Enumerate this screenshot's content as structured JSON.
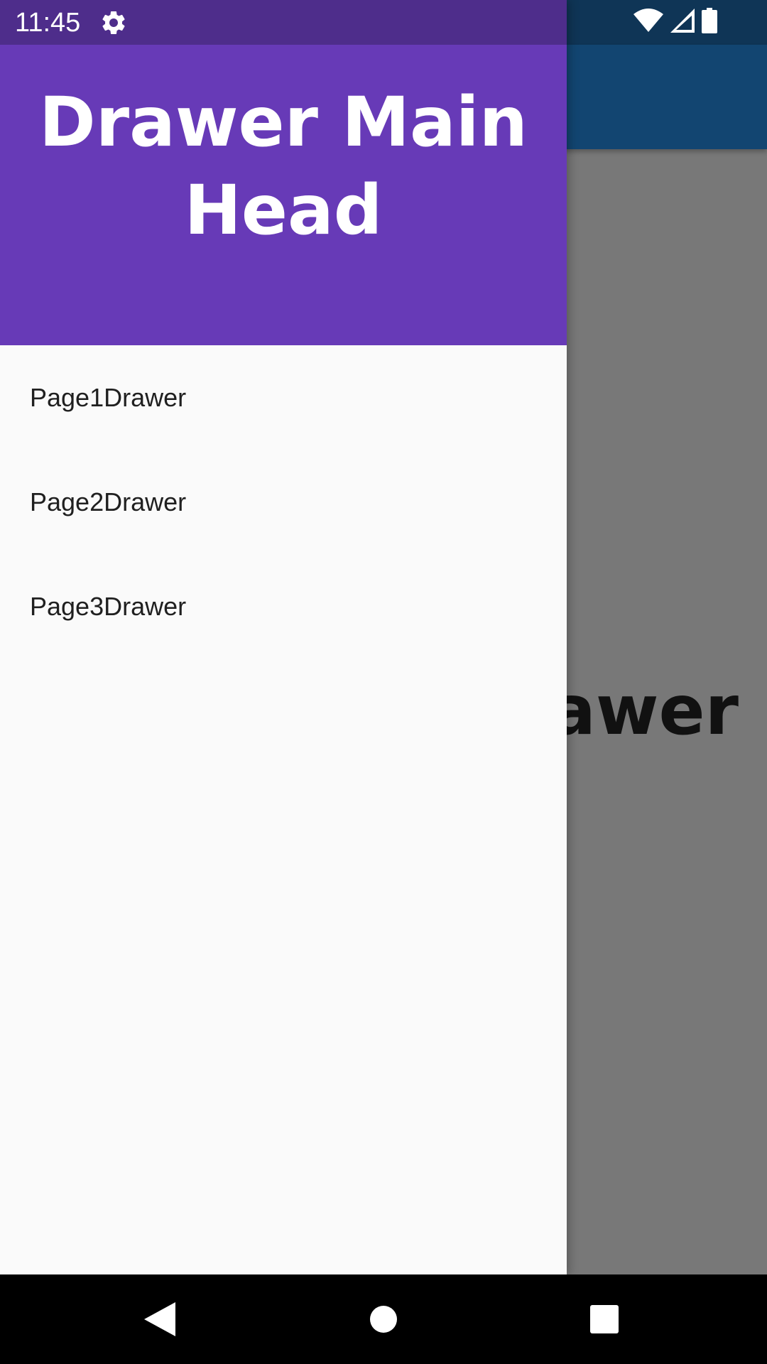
{
  "status_bar": {
    "time": "11:45",
    "icons": [
      "gear-icon",
      "wifi-icon",
      "signal-icon",
      "battery-icon"
    ]
  },
  "drawer": {
    "header_title": "Drawer Main Head",
    "items": [
      {
        "label": "Page1Drawer"
      },
      {
        "label": "Page2Drawer"
      },
      {
        "label": "Page3Drawer"
      }
    ]
  },
  "background_page": {
    "visible_text": "rawer"
  },
  "nav_bar": {
    "buttons": [
      "back-icon",
      "home-icon",
      "recents-icon"
    ]
  },
  "colors": {
    "drawer_header": "#673ab7",
    "drawer_status_bar": "#4e2d8b",
    "app_bar": "#124571",
    "scrim_background": "#787878",
    "drawer_background": "#fafafa"
  }
}
